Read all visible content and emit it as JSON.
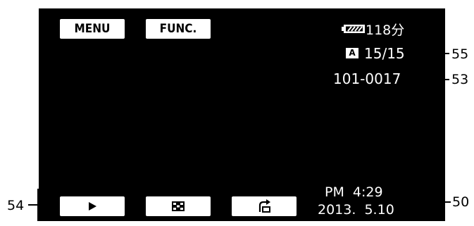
{
  "buttons": {
    "menu_label": "MENU",
    "func_label": "FUNC."
  },
  "status": {
    "battery_icon": "battery-icon",
    "battery_time": "118分",
    "mode_badge": "A",
    "counter": "15/15",
    "file_number": "101-0017"
  },
  "datetime": {
    "time": "PM  4:29",
    "date": "2013.  5.10"
  },
  "bottom_controls": [
    {
      "name": "play-button",
      "icon": "play-icon"
    },
    {
      "name": "index-button",
      "icon": "index-icon"
    },
    {
      "name": "return-button",
      "icon": "return-icon"
    }
  ],
  "callouts": {
    "c55": "55",
    "c53": "53",
    "c54": "54",
    "c50": "50"
  },
  "colors": {
    "screen": "#000000",
    "button": "#ffffff",
    "text": "#ffffff"
  }
}
